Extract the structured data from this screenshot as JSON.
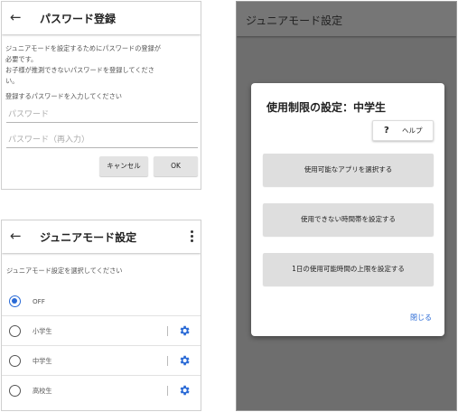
{
  "password_screen": {
    "title": "パスワード登録",
    "description_lines": [
      "ジュニアモードを設定するためにパスワードの登録が",
      "必要です。",
      "お子様が推測できないパスワードを登録してくださ",
      "い。"
    ],
    "prompt": "登録するパスワードを入力してください",
    "password_placeholder": "パスワード",
    "reenter_placeholder": "パスワード（再入力）",
    "cancel_label": "キャンセル",
    "ok_label": "OK"
  },
  "mode_screen": {
    "title": "ジュニアモード設定",
    "subhead": "ジュニアモード設定を選択してください",
    "options": [
      {
        "label": "OFF",
        "selected": true,
        "has_settings": false
      },
      {
        "label": "小学生",
        "selected": false,
        "has_settings": true
      },
      {
        "label": "中学生",
        "selected": false,
        "has_settings": true
      },
      {
        "label": "高校生",
        "selected": false,
        "has_settings": true
      }
    ],
    "accent_color": "#2a6ad6"
  },
  "restriction_screen": {
    "title": "ジュニアモード設定",
    "dialog_title": "使用制限の設定：中学生",
    "help_label": "ヘルプ",
    "help_mark": "?",
    "actions": [
      "使用可能なアプリを選択する",
      "使用できない時間帯を設定する",
      "1日の使用可能時間の上限を設定する"
    ],
    "close_label": "閉じる"
  }
}
